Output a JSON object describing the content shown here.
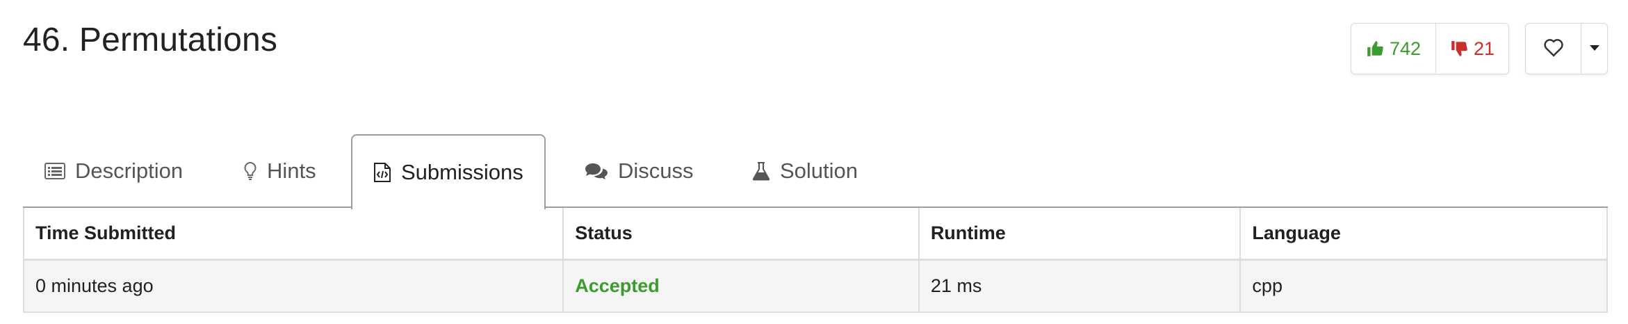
{
  "problem": {
    "title": "46. Permutations"
  },
  "votes": {
    "up_count": "742",
    "down_count": "21",
    "up_icon": "thumbs-up-icon",
    "down_icon": "thumbs-down-icon"
  },
  "favorite": {
    "icon": "heart-icon",
    "menu_icon": "caret-down-icon"
  },
  "tabs": [
    {
      "label": "Description",
      "icon": "list-icon",
      "active": false
    },
    {
      "label": "Hints",
      "icon": "lightbulb-icon",
      "active": false
    },
    {
      "label": "Submissions",
      "icon": "code-file-icon",
      "active": true
    },
    {
      "label": "Discuss",
      "icon": "comments-icon",
      "active": false
    },
    {
      "label": "Solution",
      "icon": "flask-icon",
      "active": false
    }
  ],
  "submissions": {
    "columns": [
      "Time Submitted",
      "Status",
      "Runtime",
      "Language"
    ],
    "rows": [
      {
        "time": "0 minutes ago",
        "status": "Accepted",
        "runtime": "21 ms",
        "language": "cpp"
      }
    ]
  },
  "colors": {
    "accepted": "#3c9b2e",
    "upvote": "#3c9b2e",
    "downvote": "#c9302c",
    "border": "#9e9e9e",
    "row_bg": "#f5f5f5"
  }
}
